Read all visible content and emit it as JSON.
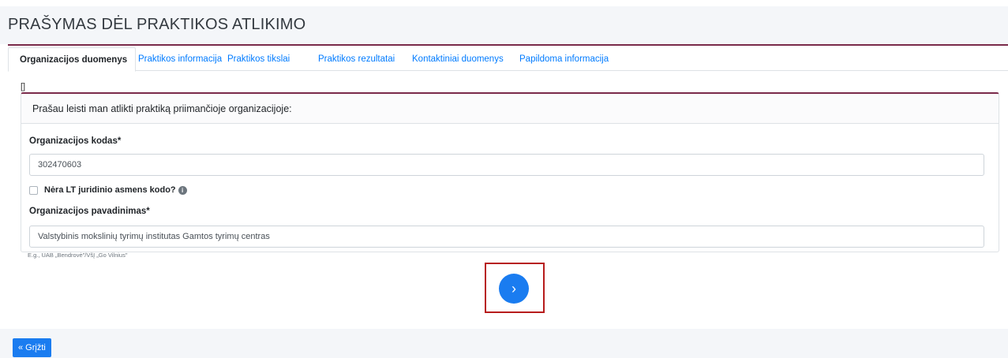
{
  "page_title": "PRAŠYMAS DĖL PRAKTIKOS ATLIKIMO",
  "tabs": [
    {
      "label": "Organizacijos duomenys",
      "active": true
    },
    {
      "label": "Praktikos informacija",
      "active": false
    },
    {
      "label": "Praktikos tikslai",
      "active": false
    },
    {
      "label": "Praktikos rezultatai",
      "active": false
    },
    {
      "label": "Kontaktiniai duomenys",
      "active": false
    },
    {
      "label": "Papildoma informacija",
      "active": false
    }
  ],
  "bracket_text": "[]",
  "section": {
    "header": "Prašau leisti man atlikti praktiką priimančioje organizacijoje:",
    "org_code_label": "Organizacijos kodas*",
    "org_code_value": "302470603",
    "no_code_checkbox_label": "Nėra LT juridinio asmens kodo?",
    "no_code_checked": false,
    "info_icon": "i",
    "org_name_label": "Organizacijos pavadinimas*",
    "org_name_value": "Valstybinis mokslinių tyrimų institutas Gamtos tyrimų centras",
    "org_name_hint": "E.g., UAB „Bendrovė\"/VšĮ „Go Vilnius\""
  },
  "next_button_icon": "›",
  "back_button_label": "« Grįžti",
  "colors": {
    "accent": "#1a7cf0",
    "card_border": "#7a2a4a",
    "highlight": "#b71c1c"
  }
}
